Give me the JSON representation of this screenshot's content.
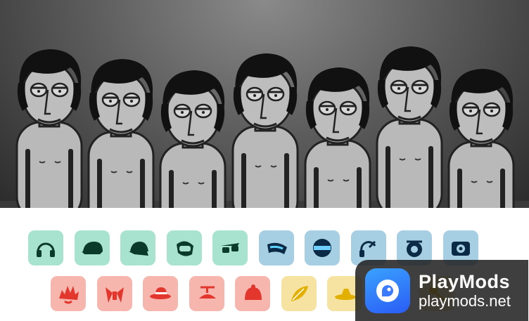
{
  "stage": {
    "performer_count": 7
  },
  "sound_icons_top": [
    {
      "name": "headphones-icon",
      "color": "green"
    },
    {
      "name": "cap-icon",
      "color": "green"
    },
    {
      "name": "cap-visor-icon",
      "color": "green"
    },
    {
      "name": "goggles-icon",
      "color": "green"
    },
    {
      "name": "sunglasses-icon",
      "color": "green"
    },
    {
      "name": "visor-glasses-icon",
      "color": "blue"
    },
    {
      "name": "round-mask-icon",
      "color": "blue"
    },
    {
      "name": "headset-icon",
      "color": "blue"
    },
    {
      "name": "ear-speaker-icon",
      "color": "blue"
    },
    {
      "name": "box-speaker-icon",
      "color": "blue"
    }
  ],
  "sound_icons_bottom": [
    {
      "name": "spiky-hair-icon",
      "color": "red"
    },
    {
      "name": "bird-wings-icon",
      "color": "red"
    },
    {
      "name": "fedora-icon",
      "color": "red"
    },
    {
      "name": "propeller-hat-icon",
      "color": "red"
    },
    {
      "name": "beanie-icon",
      "color": "red"
    },
    {
      "name": "feather-icon",
      "color": "yellow"
    },
    {
      "name": "straw-hat-icon",
      "color": "yellow"
    },
    {
      "name": "crown-icon",
      "color": "yellow"
    },
    {
      "name": "mic-icon",
      "color": "yellow"
    }
  ],
  "watermark": {
    "title": "PlayMods",
    "subtitle": "playmods.net"
  },
  "colors": {
    "green_tile": "#a8e3cf",
    "blue_tile": "#a6cfe3",
    "red_tile": "#f6b6ae",
    "yellow_tile": "#f7e3a1",
    "green_icon": "#0a3a2a",
    "blue_icon": "#0b2a45",
    "red_icon": "#e3372e",
    "yellow_icon": "#e2b000"
  }
}
